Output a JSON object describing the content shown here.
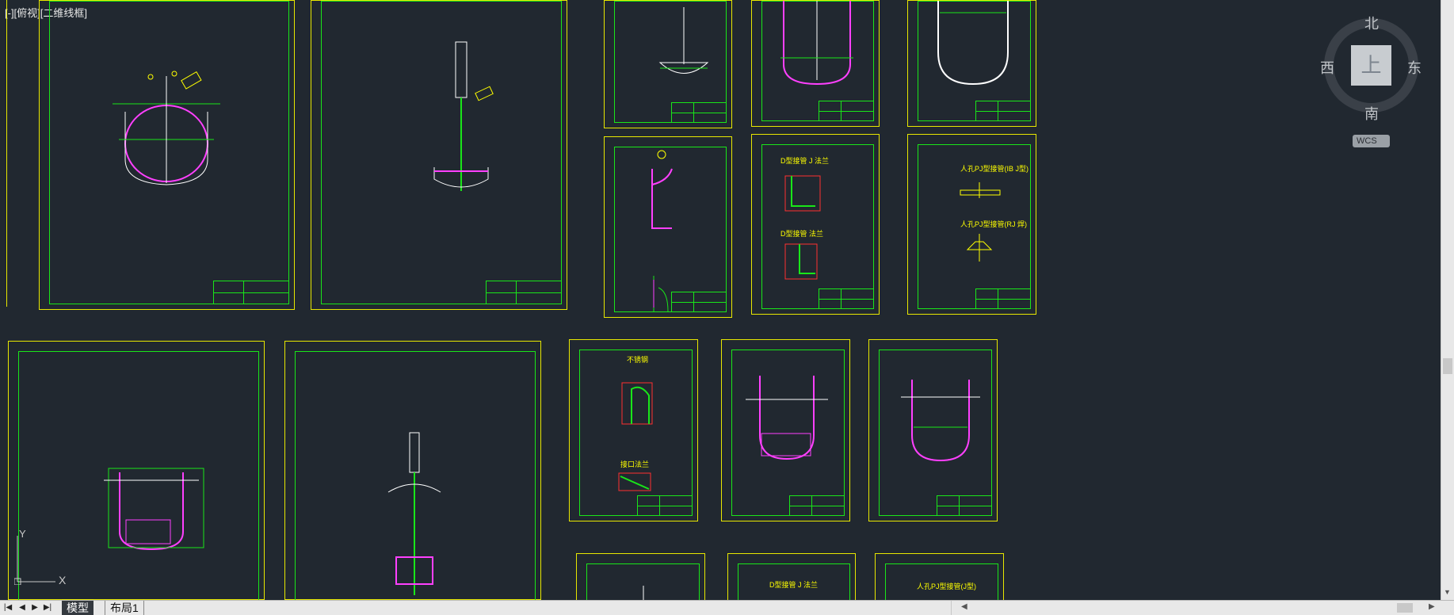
{
  "viewport": {
    "label": "[-][俯视][二维线框]"
  },
  "viewcube": {
    "north": "北",
    "south": "南",
    "east": "东",
    "west": "西",
    "face": "上",
    "coord_system": "WCS"
  },
  "ucs_icon": {
    "y_axis": "Y",
    "x_axis": "X"
  },
  "drawing_captions": {
    "detail_a": "D型接管 J 法兰",
    "detail_b": "D型接管 法兰",
    "manhole_1": "人孔PJ型接管(IB J型)",
    "manhole_2": "人孔PJ型接管(RJ 焊)",
    "section_1": "不锈钢",
    "detail_c": "接口法兰",
    "manhole_3": "人孔PJ型接管(J型)",
    "detail_d": "D型接管 J 法兰"
  },
  "tabs": {
    "model": "模型",
    "layout1": "布局1"
  },
  "colors": {
    "background": "#212830",
    "border_outer": "#e8e800",
    "border_inner": "#19e619",
    "vessel": "#ff40ff",
    "dimension": "#ffffff",
    "detail_red": "#ff3030",
    "text_yellow": "#ffff00"
  },
  "icons": [
    "first-tab-icon",
    "prev-tab-icon",
    "next-tab-icon",
    "last-tab-icon",
    "scroll-up-icon",
    "scroll-down-icon",
    "scroll-left-icon",
    "scroll-right-icon"
  ]
}
